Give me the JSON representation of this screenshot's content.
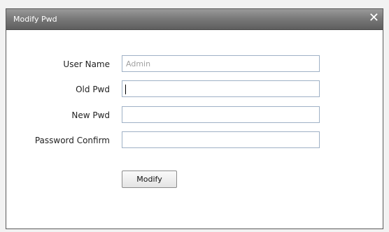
{
  "dialog": {
    "title": "Modify Pwd",
    "close_glyph": "✕"
  },
  "form": {
    "user_name": {
      "label": "User Name",
      "value": "Admin"
    },
    "old_pwd": {
      "label": "Old Pwd",
      "value": ""
    },
    "new_pwd": {
      "label": "New Pwd",
      "value": ""
    },
    "password_confirm": {
      "label": "Password Confirm",
      "value": ""
    },
    "submit_label": "Modify"
  },
  "icons": {
    "close": "close-icon"
  }
}
